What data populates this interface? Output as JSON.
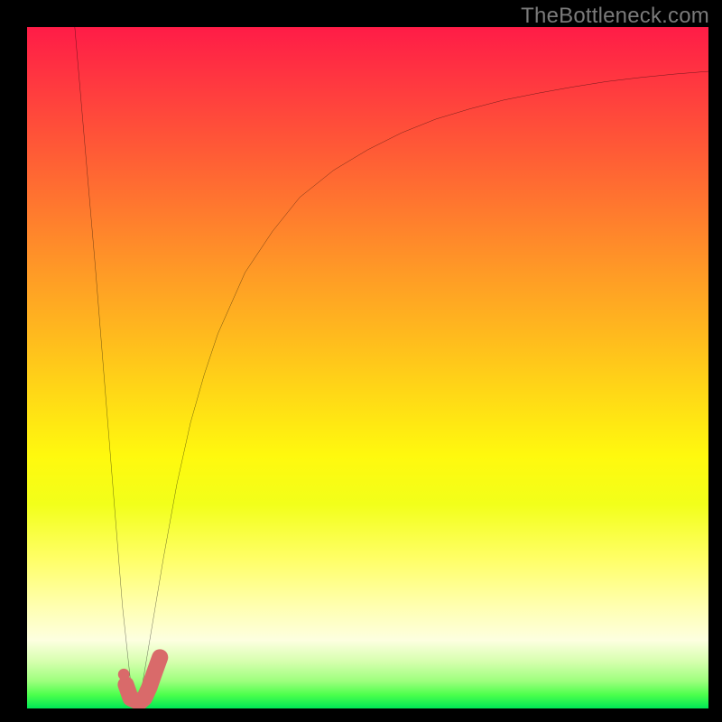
{
  "watermark": "TheBottleneck.com",
  "chart_data": {
    "type": "line",
    "title": "",
    "xlabel": "",
    "ylabel": "",
    "xlim": [
      0,
      100
    ],
    "ylim": [
      0,
      100
    ],
    "grid": false,
    "series": [
      {
        "name": "curve",
        "color": "#000000",
        "x": [
          7,
          10,
          12,
          14,
          15.5,
          16.5,
          18,
          20,
          22,
          24,
          26,
          28,
          32,
          36,
          40,
          45,
          50,
          55,
          60,
          65,
          70,
          75,
          80,
          85,
          90,
          95,
          100
        ],
        "y": [
          100,
          65,
          40,
          15,
          1,
          1,
          10,
          22,
          33,
          42,
          49,
          55,
          64,
          70,
          75,
          79,
          82,
          84.5,
          86.5,
          88,
          89.3,
          90.3,
          91.2,
          92,
          92.6,
          93.1,
          93.5
        ]
      },
      {
        "name": "marker-hook",
        "color": "#d96a6a",
        "x": [
          14.5,
          15.2,
          16.5,
          17.2,
          17.9,
          18.6,
          19.5
        ],
        "y": [
          3.5,
          1.5,
          0.9,
          1.5,
          3.0,
          5.0,
          7.5
        ]
      },
      {
        "name": "marker-dot",
        "color": "#d96a6a",
        "x": [
          14.2
        ],
        "y": [
          5.0
        ]
      }
    ]
  }
}
